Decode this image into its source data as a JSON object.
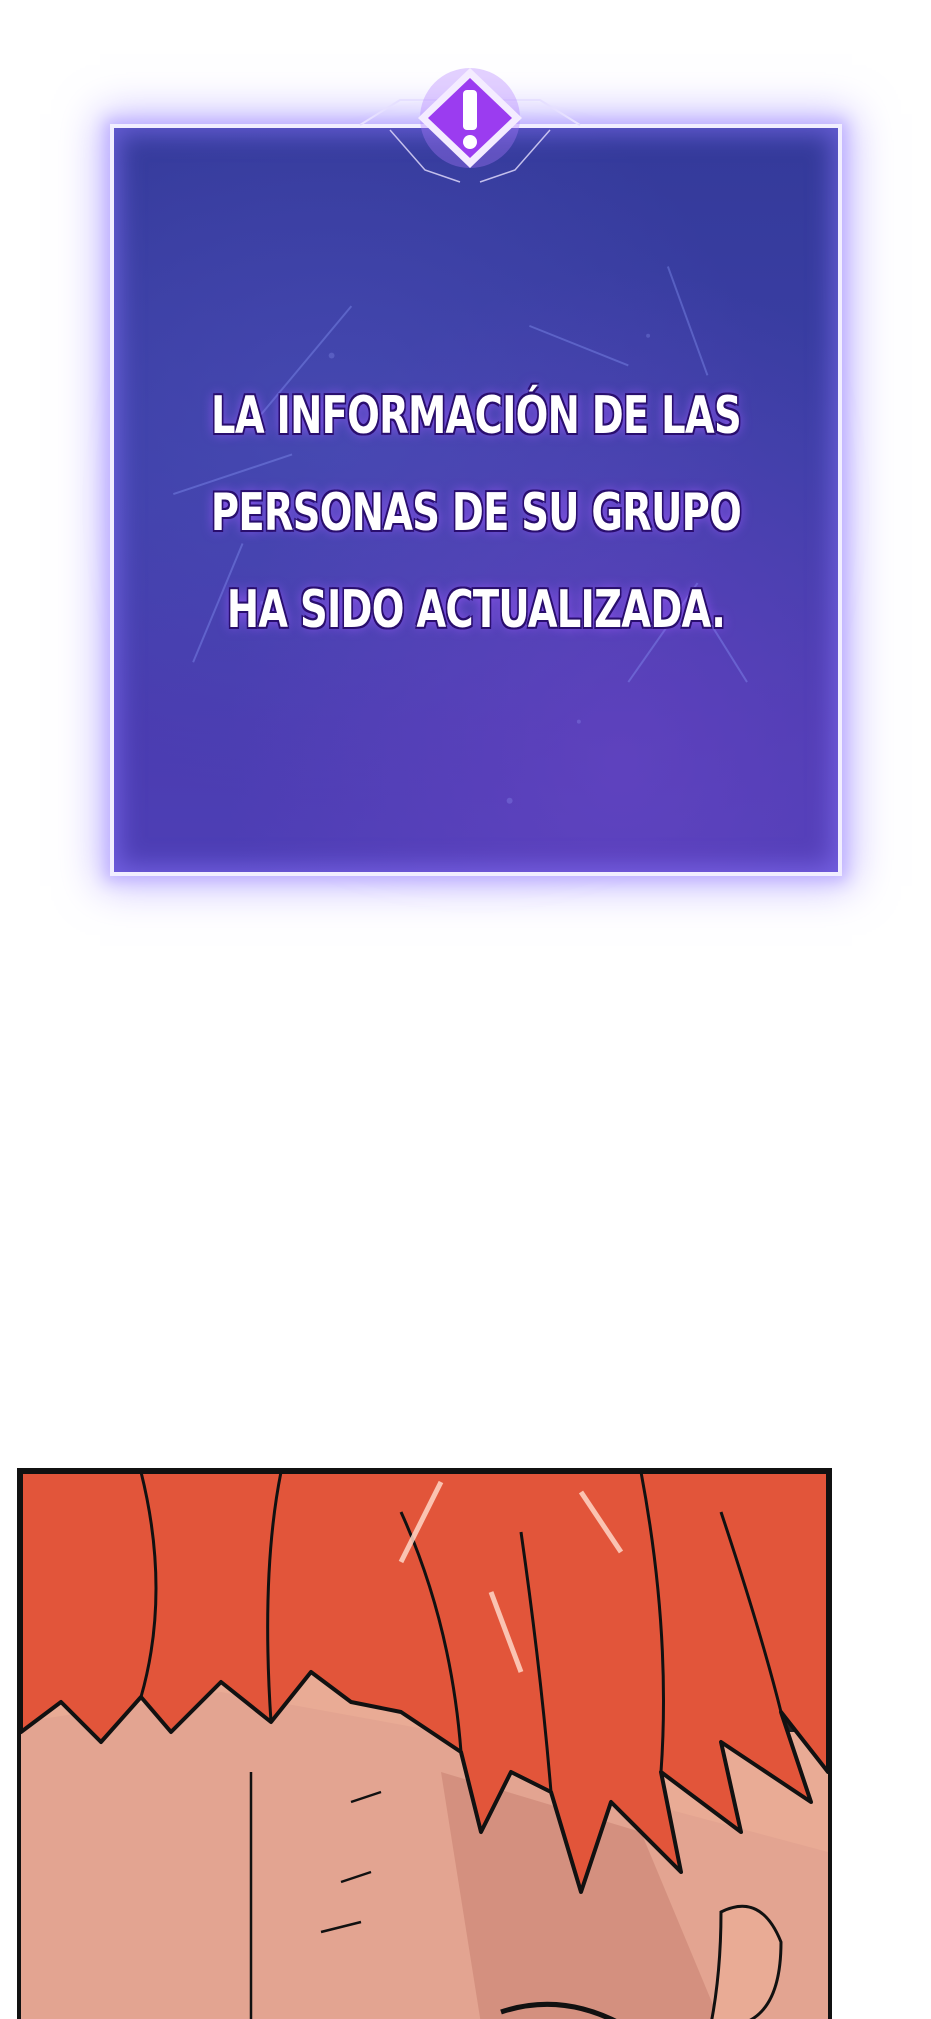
{
  "system_notification": {
    "icon": "exclamation-diamond-icon",
    "lines": [
      "LA INFORMACIÓN DE LAS",
      "PERSONAS DE SU GRUPO",
      "HA SIDO ACTUALIZADA."
    ],
    "colors": {
      "panel": "#3c3fa6",
      "border": "#f1eeff",
      "glow": "#a896ff",
      "text_outline": "#2a0f6e",
      "emblem": "#9b3cf0"
    }
  },
  "manga_panel": {
    "subject": "red-haired-character-closeup",
    "colors": {
      "hair": "#e2553a",
      "skin": "#e9ab95",
      "outline": "#111111"
    }
  }
}
